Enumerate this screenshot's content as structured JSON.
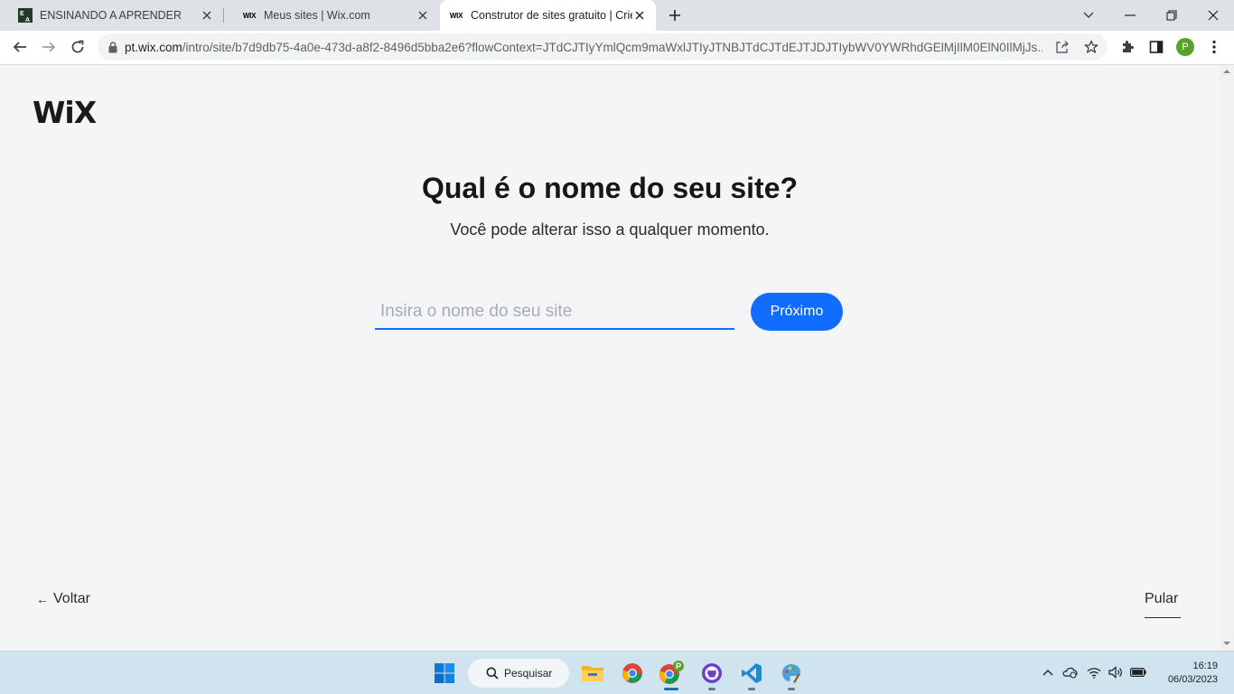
{
  "browser": {
    "tabs": [
      {
        "title": "ENSINANDO A APRENDER",
        "favicon": "ea-logo-icon",
        "active": false
      },
      {
        "title": "Meus sites | Wix.com",
        "favicon": "wix-favicon",
        "favicon_text": "WIX",
        "active": false
      },
      {
        "title": "Construtor de sites gratuito | Crie",
        "favicon": "wix-favicon",
        "favicon_text": "WIX",
        "active": true
      }
    ],
    "url_host": "pt.wix.com",
    "url_path": "/intro/site/b7d9db75-4a0e-473d-a8f2-8496d5bba2e6?flowContext=JTdCJTIyYmlQcm9maWxlJTIyJTNBJTdCJTdEJTJDJTIybWV0YWRhdGElMjIlM0ElN0IlMjJs...",
    "profile_initial": "P"
  },
  "page": {
    "logo": "WiX",
    "heading": "Qual é o nome do seu site?",
    "subheading": "Você pode alterar isso a qualquer momento.",
    "name_input": {
      "placeholder": "Insira o nome do seu site",
      "value": ""
    },
    "next_button": "Próximo",
    "back_link": "Voltar",
    "back_arrow": "←",
    "skip_link": "Pular"
  },
  "taskbar": {
    "search_label": "Pesquisar",
    "time": "16:19",
    "date": "06/03/2023"
  },
  "colors": {
    "accent": "#116dff",
    "page_background": "#f4f5f7",
    "taskbar": "#cfe4ef"
  }
}
